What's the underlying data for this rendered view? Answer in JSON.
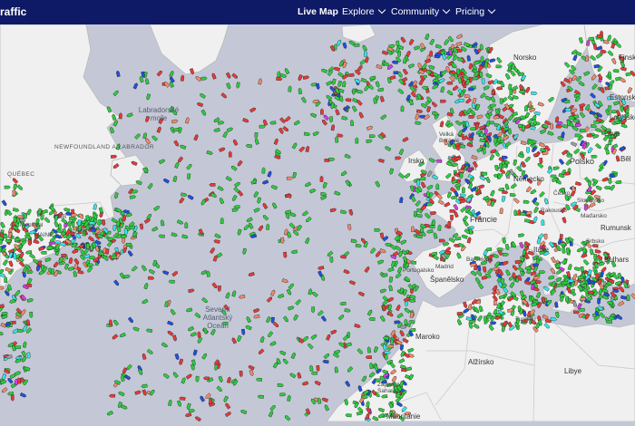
{
  "header": {
    "brand": "raffic",
    "nav": [
      {
        "label": "Live Map",
        "active": true,
        "dropdown": false
      },
      {
        "label": "Explore",
        "active": false,
        "dropdown": true
      },
      {
        "label": "Community",
        "active": false,
        "dropdown": true
      },
      {
        "label": "Pricing",
        "active": false,
        "dropdown": true
      }
    ]
  },
  "map": {
    "colors": {
      "sea": "#c4c8d6",
      "land": "#f0f0f0",
      "border": "#b9b9b9",
      "header": "#0e1a66"
    },
    "vessel_colors": {
      "cargo": "#2ecc40",
      "tanker": "#e53a3a",
      "passenger": "#2050e0",
      "fishing": "#f08a6c",
      "tug_special": "#35e6e6",
      "pleasure": "#d23de0",
      "unknown": "#9aa0a6"
    },
    "labels": {
      "sea": [
        {
          "text": "Labradorské moře"
        },
        {
          "text": "Severní Atlantský Oceán"
        }
      ],
      "regions": [
        {
          "text": "NEWFOUNDLAND A LABRADOR"
        },
        {
          "text": "QUÉBEC"
        }
      ],
      "countries": [
        {
          "text": "Norsko"
        },
        {
          "text": "Finsko"
        },
        {
          "text": "Estonsko"
        },
        {
          "text": "Lotyšsko"
        },
        {
          "text": "Litva"
        },
        {
          "text": "Běl"
        },
        {
          "text": "Velká Británie"
        },
        {
          "text": "Irsko"
        },
        {
          "text": "Německo"
        },
        {
          "text": "Polsko"
        },
        {
          "text": "Česko"
        },
        {
          "text": "Slovensko"
        },
        {
          "text": "Rakousko"
        },
        {
          "text": "Maďarsko"
        },
        {
          "text": "Rumunsk"
        },
        {
          "text": "Srbsko"
        },
        {
          "text": "Bulhars"
        },
        {
          "text": "Francie"
        },
        {
          "text": "Itálie"
        },
        {
          "text": "Španělsko"
        },
        {
          "text": "Portugalsko"
        },
        {
          "text": "Maroko"
        },
        {
          "text": "Alžírsko"
        },
        {
          "text": "Libye"
        },
        {
          "text": "Tunisko"
        },
        {
          "text": "Západní Sahara"
        },
        {
          "text": "Mauritánie"
        }
      ],
      "cities": [
        {
          "text": "Montreal"
        },
        {
          "text": "Madrid"
        },
        {
          "text": "Barcelona"
        },
        {
          "text": "Londýn"
        },
        {
          "text": "NB"
        },
        {
          "text": "MAINE"
        },
        {
          "text": "NOVÉ"
        }
      ]
    }
  }
}
